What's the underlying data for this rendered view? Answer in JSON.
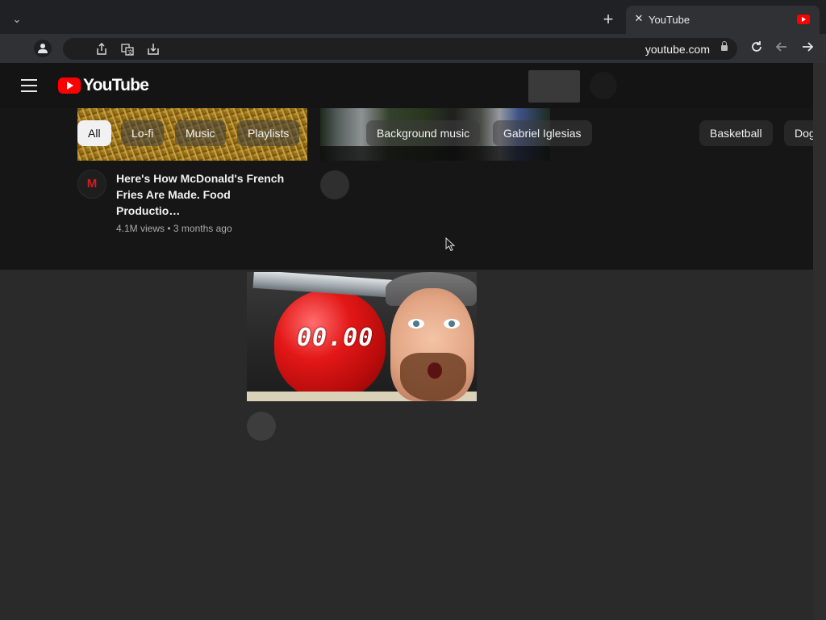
{
  "browser": {
    "tab_title": "YouTube",
    "new_tab_symbol": "+",
    "close_symbol": "✕",
    "dropdown_symbol": "⌄",
    "url": "youtube.com",
    "icons": [
      "profile-icon",
      "share-icon",
      "translate-icon",
      "download-icon",
      "lock-icon",
      "reload-icon",
      "back-icon",
      "forward-icon"
    ]
  },
  "youtube": {
    "logo_text": "YouTube",
    "chips": [
      {
        "label": "All",
        "active": true
      },
      {
        "label": "Lo-fi",
        "active": false
      },
      {
        "label": "Music",
        "active": false
      },
      {
        "label": "Playlists",
        "active": false
      },
      {
        "label": "Background music",
        "active": false
      },
      {
        "label": "Gabriel Iglesias",
        "active": false
      },
      {
        "label": "Basketball",
        "active": false
      },
      {
        "label": "Dog",
        "active": false
      }
    ],
    "video": {
      "channel_initial": "M",
      "title": "Here's How McDonald's French Fries Are Made. Food Productio…",
      "views": "4.1M views",
      "age": "3 months ago",
      "separator": "•"
    },
    "thumbnail_timer": "00.00"
  },
  "colors": {
    "brand_red": "#ff0000",
    "page_bg": "#2a2a2a",
    "topbar_bg": "#141414"
  }
}
